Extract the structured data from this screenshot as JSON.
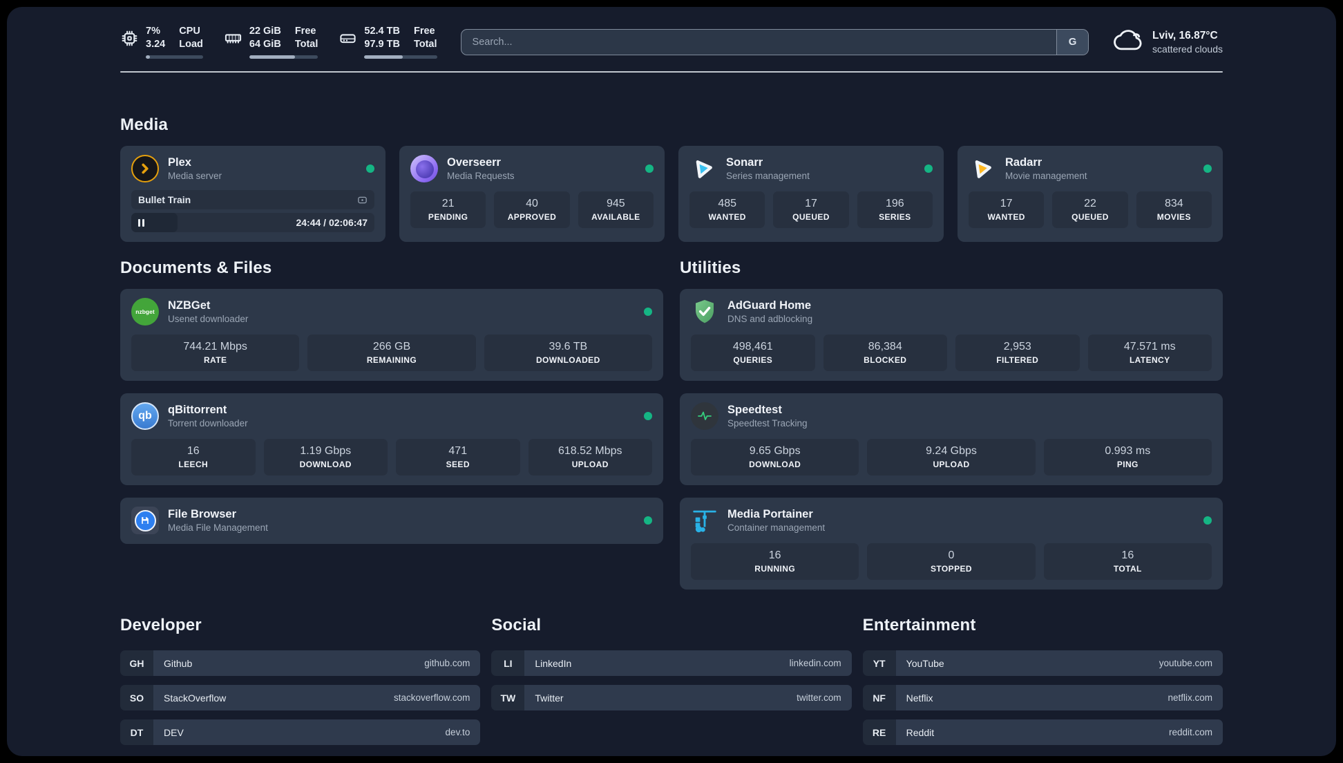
{
  "topbar": {
    "stats": [
      {
        "value_top": "7%",
        "value_bottom": "3.24",
        "label_top": "CPU",
        "label_bottom": "Load",
        "progress": 7
      },
      {
        "value_top": "22 GiB",
        "value_bottom": "64 GiB",
        "label_top": "Free",
        "label_bottom": "Total",
        "progress": 66
      },
      {
        "value_top": "52.4 TB",
        "value_bottom": "97.9 TB",
        "label_top": "Free",
        "label_bottom": "Total",
        "progress": 53
      }
    ],
    "search": {
      "placeholder": "Search...",
      "engine_button": "G"
    },
    "weather": {
      "location_temp": "Lviv, 16.87°C",
      "condition": "scattered clouds"
    }
  },
  "media": {
    "title": "Media",
    "plex": {
      "name": "Plex",
      "subtitle": "Media server",
      "online": true,
      "now_playing": {
        "title": "Bullet Train",
        "time_display": "24:44 / 02:06:47",
        "progress": 19,
        "state": "paused"
      }
    },
    "apps": [
      {
        "name": "Overseerr",
        "subtitle": "Media Requests",
        "online": true,
        "stats": [
          {
            "value": "21",
            "label": "PENDING"
          },
          {
            "value": "40",
            "label": "APPROVED"
          },
          {
            "value": "945",
            "label": "AVAILABLE"
          }
        ]
      },
      {
        "name": "Sonarr",
        "subtitle": "Series management",
        "online": true,
        "stats": [
          {
            "value": "485",
            "label": "WANTED"
          },
          {
            "value": "17",
            "label": "QUEUED"
          },
          {
            "value": "196",
            "label": "SERIES"
          }
        ]
      },
      {
        "name": "Radarr",
        "subtitle": "Movie management",
        "online": true,
        "stats": [
          {
            "value": "17",
            "label": "WANTED"
          },
          {
            "value": "22",
            "label": "QUEUED"
          },
          {
            "value": "834",
            "label": "MOVIES"
          }
        ]
      }
    ]
  },
  "documents": {
    "title": "Documents & Files",
    "apps": [
      {
        "name": "NZBGet",
        "subtitle": "Usenet downloader",
        "online": true,
        "stats": [
          {
            "value": "744.21 Mbps",
            "label": "RATE"
          },
          {
            "value": "266 GB",
            "label": "REMAINING"
          },
          {
            "value": "39.6 TB",
            "label": "DOWNLOADED"
          }
        ]
      },
      {
        "name": "qBittorrent",
        "subtitle": "Torrent downloader",
        "online": true,
        "stats": [
          {
            "value": "16",
            "label": "LEECH"
          },
          {
            "value": "1.19 Gbps",
            "label": "DOWNLOAD"
          },
          {
            "value": "471",
            "label": "SEED"
          },
          {
            "value": "618.52 Mbps",
            "label": "UPLOAD"
          }
        ]
      },
      {
        "name": "File Browser",
        "subtitle": "Media File Management",
        "online": true,
        "stats": []
      }
    ]
  },
  "utilities": {
    "title": "Utilities",
    "apps": [
      {
        "name": "AdGuard Home",
        "subtitle": "DNS and adblocking",
        "online": false,
        "stats": [
          {
            "value": "498,461",
            "label": "QUERIES"
          },
          {
            "value": "86,384",
            "label": "BLOCKED"
          },
          {
            "value": "2,953",
            "label": "FILTERED"
          },
          {
            "value": "47.571 ms",
            "label": "LATENCY"
          }
        ]
      },
      {
        "name": "Speedtest",
        "subtitle": "Speedtest Tracking",
        "online": false,
        "stats": [
          {
            "value": "9.65 Gbps",
            "label": "DOWNLOAD"
          },
          {
            "value": "9.24 Gbps",
            "label": "UPLOAD"
          },
          {
            "value": "0.993 ms",
            "label": "PING"
          }
        ]
      },
      {
        "name": "Media Portainer",
        "subtitle": "Container management",
        "online": true,
        "stats": [
          {
            "value": "16",
            "label": "RUNNING"
          },
          {
            "value": "0",
            "label": "STOPPED"
          },
          {
            "value": "16",
            "label": "TOTAL"
          }
        ]
      }
    ]
  },
  "bookmarks": [
    {
      "title": "Developer",
      "items": [
        {
          "abbr": "GH",
          "name": "Github",
          "url": "github.com"
        },
        {
          "abbr": "SO",
          "name": "StackOverflow",
          "url": "stackoverflow.com"
        },
        {
          "abbr": "DT",
          "name": "DEV",
          "url": "dev.to"
        }
      ]
    },
    {
      "title": "Social",
      "items": [
        {
          "abbr": "LI",
          "name": "LinkedIn",
          "url": "linkedin.com"
        },
        {
          "abbr": "TW",
          "name": "Twitter",
          "url": "twitter.com"
        }
      ]
    },
    {
      "title": "Entertainment",
      "items": [
        {
          "abbr": "YT",
          "name": "YouTube",
          "url": "youtube.com"
        },
        {
          "abbr": "NF",
          "name": "Netflix",
          "url": "netflix.com"
        },
        {
          "abbr": "RE",
          "name": "Reddit",
          "url": "reddit.com"
        }
      ]
    }
  ],
  "colors": {
    "status-green": "#15b584",
    "bg-page": "#161c2c",
    "bg-card": "#2d3849",
    "bg-stat": "#27303f",
    "divider": "#dfe5ec",
    "bar-fill": "#a2aebf",
    "bar-track": "#3d4a5d",
    "plex-amber": "#e5a00d",
    "sonarr-blue": "#38c1f1",
    "radarr-yellow": "#ffb821",
    "portainer-blue": "#29b1e6",
    "adguard-green": "#5fb370",
    "speedtest-green": "#35d07f",
    "overseerr-purple": "#8d6bf2",
    "nzbget-green": "#43a53a",
    "qbittorrent-blue": "#3a7bd0",
    "filebrowser-blue": "#2d7ff0"
  }
}
